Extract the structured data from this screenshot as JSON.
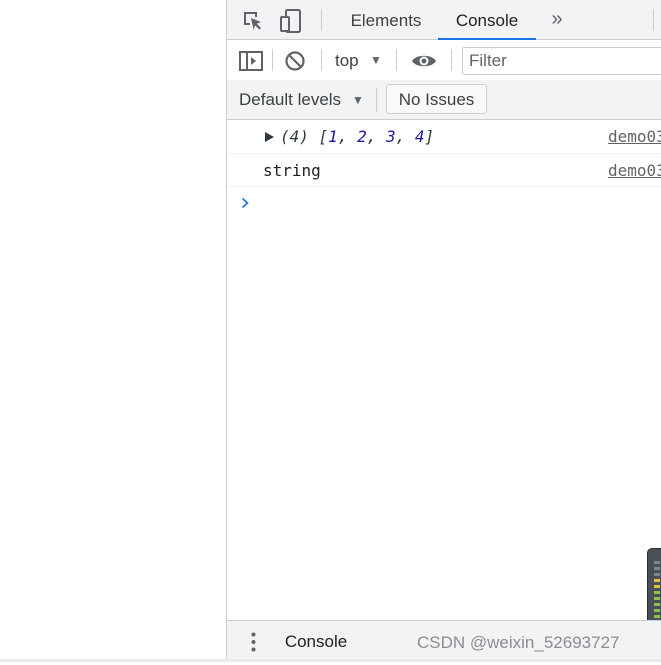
{
  "tabs": {
    "elements": "Elements",
    "console": "Console",
    "more": "»"
  },
  "toolbar": {
    "context": "top",
    "filter_placeholder": "Filter"
  },
  "levels": {
    "label": "Default levels",
    "issues": "No Issues"
  },
  "messages": [
    {
      "type": "array",
      "length_prefix": "(4)",
      "values": [
        "1",
        "2",
        "3",
        "4"
      ],
      "source": "demo03"
    },
    {
      "type": "string",
      "text": "string",
      "source": "demo03"
    }
  ],
  "drawer": {
    "tab": "Console"
  },
  "watermark": "CSDN @weixin_52693727",
  "colors": {
    "accent": "#1a73e8",
    "array_number": "#1a1aa6",
    "toolbar_bg": "#f1f3f4"
  },
  "icons": [
    "inspect-element-icon",
    "device-toolbar-icon",
    "sidebar-toggle-icon",
    "clear-console-icon",
    "eye-icon",
    "chevron-right-icon",
    "expand-triangle-icon",
    "kebab-menu-icon"
  ]
}
